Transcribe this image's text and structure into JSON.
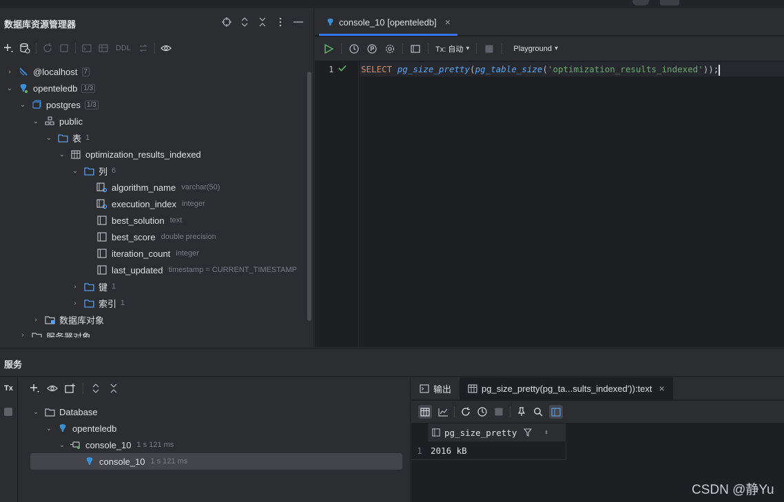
{
  "colors": {
    "accent": "#3574f0",
    "run_green": "#5fb865",
    "keyword": "#cf8e6d",
    "function": "#56a8f5",
    "string": "#6aab73"
  },
  "explorer": {
    "title": "数据库资源管理器",
    "header_icons": [
      "crosshair-icon",
      "expand-icon",
      "collapse-icon",
      "more-icon",
      "minimize-icon"
    ],
    "toolbar_ddl": "DDL",
    "tree": [
      {
        "label": "@localhost",
        "count": "7"
      },
      {
        "label": "openteledb",
        "count": "1/3"
      },
      {
        "label": "postgres",
        "count": "1/3"
      },
      {
        "label": "public"
      },
      {
        "label": "表",
        "count": "1"
      },
      {
        "label": "optimization_results_indexed"
      },
      {
        "label": "列",
        "count": "6"
      },
      {
        "label": "algorithm_name",
        "type": "varchar(50)"
      },
      {
        "label": "execution_index",
        "type": "integer"
      },
      {
        "label": "best_solution",
        "type": "text"
      },
      {
        "label": "best_score",
        "type": "double precision"
      },
      {
        "label": "iteration_count",
        "type": "integer"
      },
      {
        "label": "last_updated",
        "type": "timestamp = CURRENT_TIMESTAMP"
      },
      {
        "label": "键",
        "count": "1"
      },
      {
        "label": "索引",
        "count": "1"
      },
      {
        "label": "数据库对象"
      },
      {
        "label": "服务器对象"
      }
    ]
  },
  "editor": {
    "tab_label": "console_10 [openteledb]",
    "tx_label": "Tx: 自动",
    "playground_label": "Playground",
    "line_number": "1",
    "code": {
      "kw": "SELECT",
      "fn1": "pg_size_pretty",
      "p1": "(",
      "fn2": "pg_table_size",
      "p2": "(",
      "str": "'optimization_results_indexed'",
      "p3": "));"
    }
  },
  "services": {
    "title": "服务",
    "tx_label": "Tx",
    "tree": [
      {
        "label": "Database"
      },
      {
        "label": "openteledb"
      },
      {
        "label": "console_10",
        "time": "1 s 121 ms"
      },
      {
        "label": "console_10",
        "time": "1 s 121 ms"
      }
    ]
  },
  "results": {
    "output_tab": "输出",
    "result_tab": "pg_size_pretty(pg_ta...sults_indexed')):text",
    "column_header": "pg_size_pretty",
    "row_number": "1",
    "value": "2016 kB"
  },
  "watermark": "CSDN @静Yu"
}
